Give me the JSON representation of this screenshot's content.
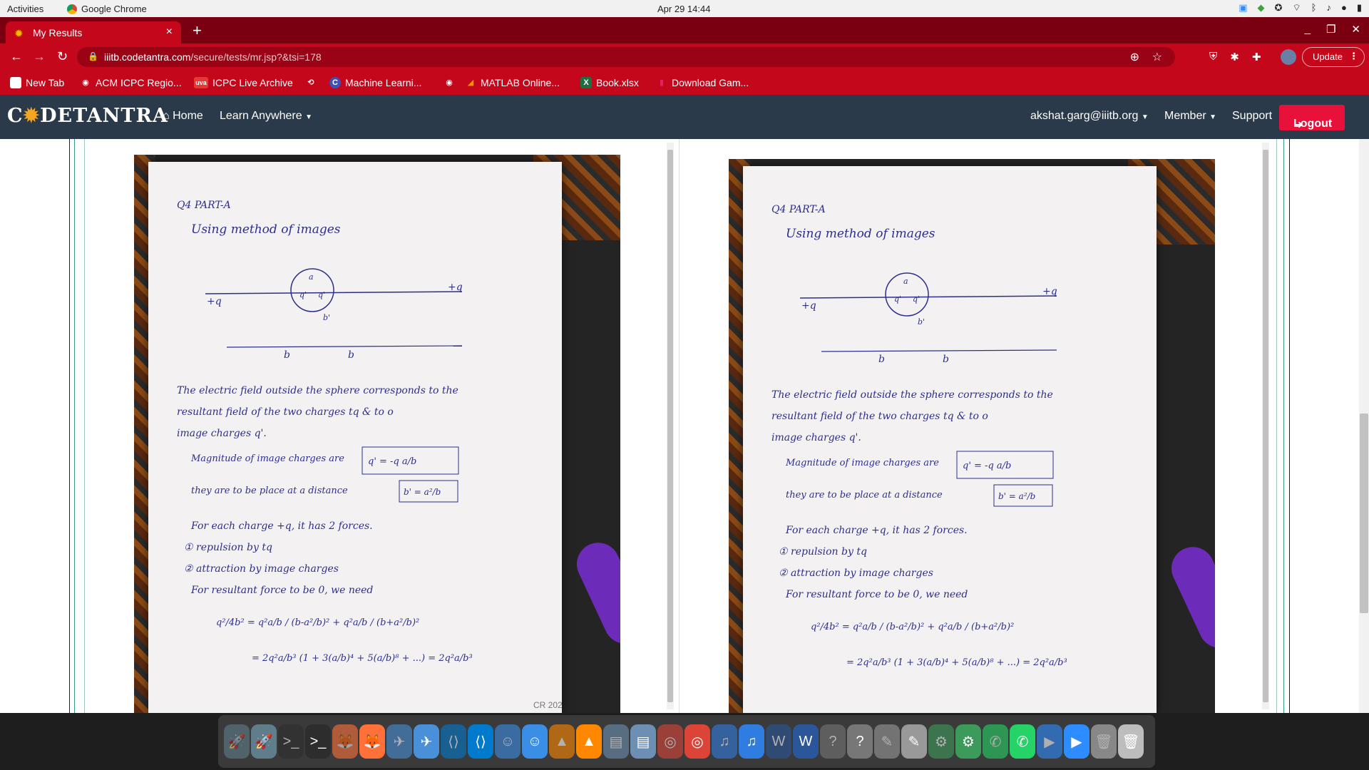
{
  "system": {
    "activities": "Activities",
    "app_name": "Google Chrome",
    "clock": "Apr 29  14:44"
  },
  "browser": {
    "tab_title": "My Results",
    "url_host": "iiitb.codetantra.com",
    "url_path": "/secure/tests/mr.jsp?&tsi=178",
    "update_label": "Update",
    "bookmarks": [
      {
        "label": "New Tab",
        "icon": "page-icon",
        "color": "#ffffff"
      },
      {
        "label": "ACM ICPC Regio...",
        "icon": "globe-icon",
        "color": "#ffffff"
      },
      {
        "label": "ICPC Live Archive",
        "icon": "uva-icon",
        "color": "#e53935"
      },
      {
        "label": "",
        "icon": "history-icon",
        "color": "#ffffff"
      },
      {
        "label": "Machine Learni...",
        "icon": "c-icon",
        "color": "#3f51b5"
      },
      {
        "label": "",
        "icon": "globe-icon",
        "color": "#ffffff"
      },
      {
        "label": "MATLAB Online...",
        "icon": "matlab-icon",
        "color": "#ff9800"
      },
      {
        "label": "Book.xlsx",
        "icon": "excel-icon",
        "color": "#1d6f42"
      },
      {
        "label": "Download Gam...",
        "icon": "bookmark-icon",
        "color": "#e91e63"
      }
    ]
  },
  "site": {
    "logo_text": "CODETANTRA",
    "home_label": "Home",
    "learn_label": "Learn Anywhere",
    "user_email": "akshat.garg@iiitb.org",
    "member_label": "Member",
    "support_label": "Support",
    "logout_label": "Logout"
  },
  "document": {
    "heading": "Q4 PART-A",
    "intro": "Using method of images",
    "diagram_labels": {
      "charge_left": "+q",
      "charge_right": "+q",
      "inner_a1": "q'",
      "inner_a2": "q'",
      "a_top": "a",
      "b_left": "b",
      "b_right": "b",
      "b_prime": "b'"
    },
    "lines": [
      "The electric field outside the sphere corresponds to the",
      "resultant field of the two charges tq & to o",
      "image charges q'.",
      "Magnitude of image charges are",
      "they are to be place at a distance",
      "For each charge +q, it has 2 forces.",
      "① repulsion by tq",
      "② attraction by image charges",
      "For resultant force to be 0, we need"
    ],
    "box_1": "q' = -q a/b",
    "box_2": "b' = a²/b",
    "equation_1": "q²/4b² = q²a/b / (b-a²/b)² + q²a/b / (b+a²/b)²",
    "equation_2": "= 2q²a/b³ (1 + 3(a/b)⁴ + 5(a/b)⁸ + ...) = 2q²a/b³",
    "photo_caption": "CR 202"
  },
  "dock_apps": [
    {
      "name": "launcher-icon",
      "glyph": "🚀",
      "color": "#607d8b"
    },
    {
      "name": "terminal-icon",
      "glyph": ">_",
      "color": "#2d2d2d"
    },
    {
      "name": "firefox-icon",
      "glyph": "🦊",
      "color": "#ff7139"
    },
    {
      "name": "preview-icon",
      "glyph": "✈",
      "color": "#4a90d9"
    },
    {
      "name": "vscode-icon",
      "glyph": "⟨⟩",
      "color": "#007acc"
    },
    {
      "name": "finder-icon",
      "glyph": "☺",
      "color": "#3a8ee6"
    },
    {
      "name": "vlc-icon",
      "glyph": "▲",
      "color": "#ff8800"
    },
    {
      "name": "files-icon",
      "glyph": "▤",
      "color": "#6d8fb3"
    },
    {
      "name": "chrome-icon",
      "glyph": "◎",
      "color": "#db4437"
    },
    {
      "name": "music-icon",
      "glyph": "♫",
      "color": "#2f7de1"
    },
    {
      "name": "word-icon",
      "glyph": "W",
      "color": "#2b579a"
    },
    {
      "name": "help-icon",
      "glyph": "?",
      "color": "#777777"
    },
    {
      "name": "notes-icon",
      "glyph": "✎",
      "color": "#999999"
    },
    {
      "name": "network-icon",
      "glyph": "⚙",
      "color": "#3c9b5b"
    },
    {
      "name": "whatsapp-icon",
      "glyph": "✆",
      "color": "#25d366"
    },
    {
      "name": "zoom-icon",
      "glyph": "▶",
      "color": "#2d8cff"
    },
    {
      "name": "trash-icon",
      "glyph": "🗑",
      "color": "#bdbdbd"
    }
  ],
  "colors": {
    "tabstrip": "#7a0011",
    "toolbar": "#c5071b",
    "site_nav": "#2b3a4a",
    "logout": "#e8113a",
    "ink": "#2c2f8c"
  }
}
